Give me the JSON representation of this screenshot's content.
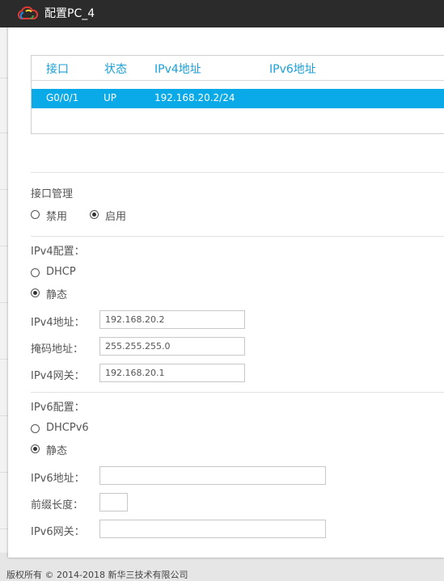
{
  "window": {
    "title": "配置PC_4"
  },
  "interface_table": {
    "columns": [
      "接口",
      "状态",
      "IPv4地址",
      "IPv6地址"
    ],
    "rows": [
      {
        "interface": "G0/0/1",
        "status": "UP",
        "ipv4": "192.168.20.2/24",
        "ipv6": ""
      }
    ]
  },
  "interface_mgmt": {
    "heading": "接口管理",
    "options": [
      "禁用",
      "启用"
    ],
    "selected": "启用"
  },
  "ipv4": {
    "heading": "IPv4配置：",
    "options": [
      "DHCP",
      "静态"
    ],
    "selected": "静态",
    "address_label": "IPv4地址：",
    "address_value": "192.168.20.2",
    "mask_label": "掩码地址：",
    "mask_value": "255.255.255.0",
    "gateway_label": "IPv4网关：",
    "gateway_value": "192.168.20.1"
  },
  "ipv6": {
    "heading": "IPv6配置：",
    "options": [
      "DHCPv6",
      "静态"
    ],
    "selected": "静态",
    "address_label": "IPv6地址：",
    "address_value": "",
    "prefix_label": "前缀长度：",
    "prefix_value": "",
    "gateway_label": "IPv6网关：",
    "gateway_value": ""
  },
  "footer": {
    "copyright": "版权所有 © 2014-2018 新华三技术有限公司"
  },
  "colors": {
    "accent": "#0aa9e8",
    "header_text": "#1aa0d8",
    "titlebar": "#2b2b2b"
  }
}
